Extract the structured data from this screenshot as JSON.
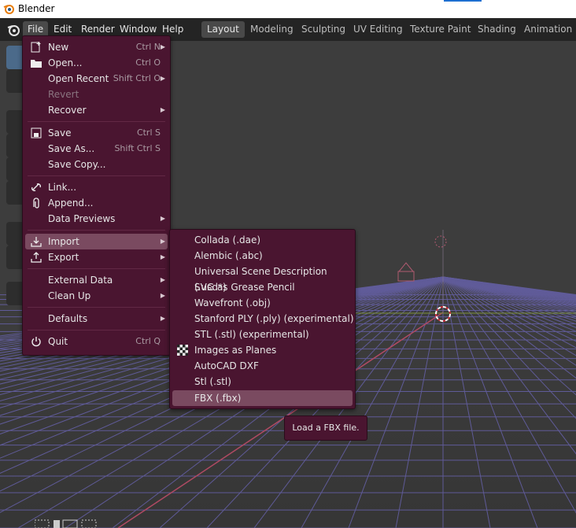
{
  "window": {
    "title": "Blender"
  },
  "menubar": {
    "items": [
      "File",
      "Edit",
      "Render",
      "Window",
      "Help"
    ]
  },
  "workspaces": [
    "Layout",
    "Modeling",
    "Sculpting",
    "UV Editing",
    "Texture Paint",
    "Shading",
    "Animation"
  ],
  "file_menu": {
    "items": [
      {
        "label": "New",
        "shortcut": "Ctrl N",
        "icon": "new-file-icon",
        "submenu": true
      },
      {
        "label": "Open...",
        "shortcut": "Ctrl O",
        "icon": "folder-icon"
      },
      {
        "label": "Open Recent",
        "shortcut": "Shift Ctrl O",
        "submenu": true
      },
      {
        "label": "Revert",
        "disabled": true
      },
      {
        "label": "Recover",
        "submenu": true
      },
      {
        "label": "Save",
        "shortcut": "Ctrl S",
        "icon": "save-icon"
      },
      {
        "label": "Save As...",
        "shortcut": "Shift Ctrl S"
      },
      {
        "label": "Save Copy..."
      },
      {
        "label": "Link...",
        "icon": "link-icon"
      },
      {
        "label": "Append...",
        "icon": "append-icon"
      },
      {
        "label": "Data Previews",
        "submenu": true
      },
      {
        "label": "Import",
        "icon": "import-icon",
        "submenu": true,
        "highlighted": true
      },
      {
        "label": "Export",
        "icon": "export-icon",
        "submenu": true
      },
      {
        "label": "External Data",
        "submenu": true
      },
      {
        "label": "Clean Up",
        "submenu": true
      },
      {
        "label": "Defaults",
        "submenu": true
      },
      {
        "label": "Quit",
        "shortcut": "Ctrl Q",
        "icon": "quit-icon"
      }
    ]
  },
  "import_menu": {
    "items": [
      {
        "label": "Collada (.dae)"
      },
      {
        "label": "Alembic (.abc)"
      },
      {
        "label": "Universal Scene Description (.usd*)"
      },
      {
        "label": "SVG as Grease Pencil"
      },
      {
        "label": "Wavefront (.obj)"
      },
      {
        "label": "Stanford PLY (.ply) (experimental)"
      },
      {
        "label": "STL (.stl) (experimental)"
      },
      {
        "label": "Images as Planes",
        "icon": "checker-image-icon"
      },
      {
        "label": "AutoCAD DXF"
      },
      {
        "label": "Stl (.stl)"
      },
      {
        "label": "FBX (.fbx)",
        "highlighted": true
      }
    ]
  },
  "tooltip": {
    "text": "Load a FBX file."
  },
  "colors": {
    "menu_bg": "#4a1530",
    "highlight": "#7a4a60",
    "grid": "#6c66b8",
    "x_axis": "#b04a63",
    "y_axis": "#7c8f3a"
  }
}
